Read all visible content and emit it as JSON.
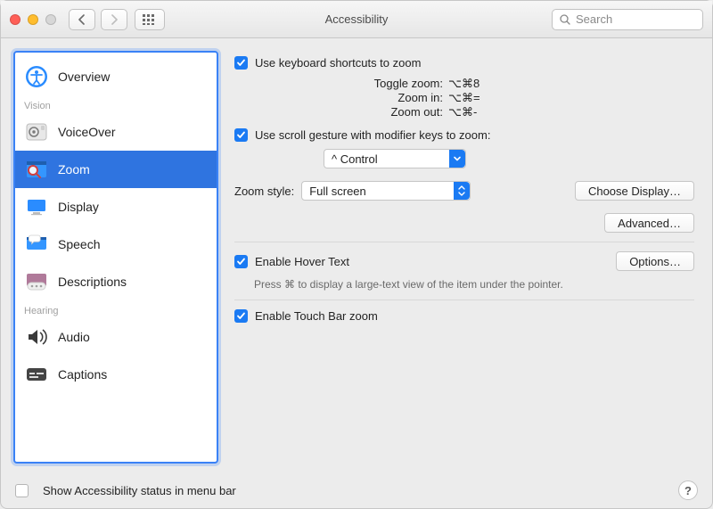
{
  "window": {
    "title": "Accessibility",
    "search_placeholder": "Search"
  },
  "sidebar": {
    "categories": [
      {
        "label": "",
        "items": [
          {
            "label": "Overview",
            "icon": "accessibility-icon",
            "selected": false
          }
        ]
      },
      {
        "label": "Vision",
        "items": [
          {
            "label": "VoiceOver",
            "icon": "voiceover-icon",
            "selected": false
          },
          {
            "label": "Zoom",
            "icon": "zoom-icon",
            "selected": true
          },
          {
            "label": "Display",
            "icon": "display-icon",
            "selected": false
          },
          {
            "label": "Speech",
            "icon": "speech-icon",
            "selected": false
          },
          {
            "label": "Descriptions",
            "icon": "descriptions-icon",
            "selected": false
          }
        ]
      },
      {
        "label": "Hearing",
        "items": [
          {
            "label": "Audio",
            "icon": "audio-icon",
            "selected": false
          },
          {
            "label": "Captions",
            "icon": "captions-icon",
            "selected": false
          }
        ]
      }
    ]
  },
  "main": {
    "keyboard_shortcuts": {
      "label": "Use keyboard shortcuts to zoom",
      "checked": true,
      "rows": [
        {
          "label": "Toggle zoom:",
          "value": "⌥⌘8"
        },
        {
          "label": "Zoom in:",
          "value": "⌥⌘="
        },
        {
          "label": "Zoom out:",
          "value": "⌥⌘-"
        }
      ]
    },
    "scroll_gesture": {
      "label": "Use scroll gesture with modifier keys to zoom:",
      "checked": true,
      "modifier": "^ Control"
    },
    "zoom_style": {
      "label": "Zoom style:",
      "value": "Full screen",
      "choose_display": "Choose Display…"
    },
    "advanced": "Advanced…",
    "hover_text": {
      "label": "Enable Hover Text",
      "checked": true,
      "options": "Options…",
      "hint": "Press ⌘ to display a large-text view of the item under the pointer."
    },
    "touch_bar": {
      "label": "Enable Touch Bar zoom",
      "checked": true
    }
  },
  "footer": {
    "status_label": "Show Accessibility status in menu bar",
    "status_checked": false,
    "help": "?"
  }
}
